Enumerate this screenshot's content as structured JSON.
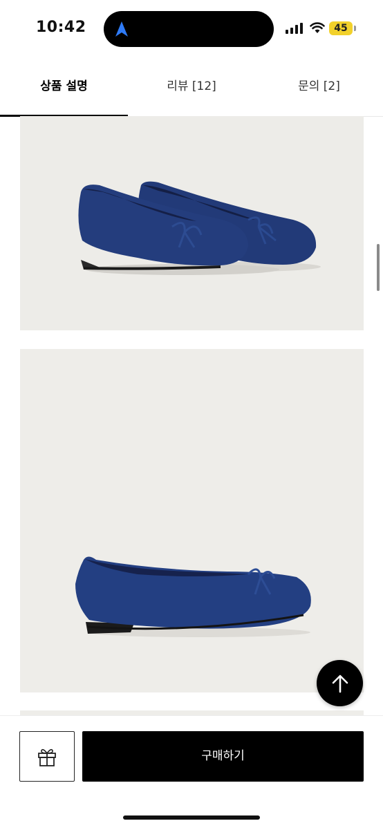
{
  "status_bar": {
    "time": "10:42",
    "battery": "45",
    "battery_color": "#f2d12b"
  },
  "tabs": [
    {
      "label": "상품 설명",
      "active": true
    },
    {
      "label": "리뷰 [12]",
      "active": false
    },
    {
      "label": "문의 [2]",
      "active": false
    }
  ],
  "images": [
    {
      "name": "pair of navy suede ballet flats with bow"
    },
    {
      "name": "single navy suede ballet flat side view"
    }
  ],
  "bottom_bar": {
    "gift_icon": "gift-icon",
    "buy_label": "구매하기"
  },
  "colors": {
    "navy": "#1f3a78",
    "background": "#eeede9"
  }
}
